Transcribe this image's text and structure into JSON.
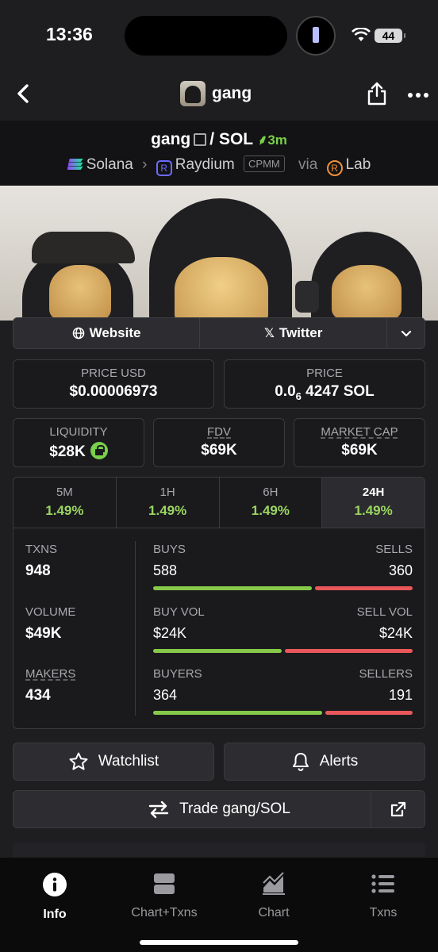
{
  "status_bar": {
    "time": "13:36",
    "battery": "44"
  },
  "header": {
    "title": "gang"
  },
  "pair": {
    "base": "gang",
    "quote": "SOL",
    "separator": "/",
    "age": "3m",
    "chain": "Solana",
    "dex": "Raydium",
    "pool_type": "CPMM",
    "via_label": "via",
    "launchpad": "Lab"
  },
  "links": {
    "website": "Website",
    "twitter": "Twitter"
  },
  "prices": {
    "price_usd_label": "PRICE USD",
    "price_usd": "$0.00006973",
    "price_label": "PRICE",
    "price_native_prefix": "0.0",
    "price_native_sub": "6",
    "price_native_rest": "4247 SOL"
  },
  "metrics": {
    "liquidity_label": "LIQUIDITY",
    "liquidity": "$28K",
    "fdv_label": "FDV",
    "fdv": "$69K",
    "mcap_label": "MARKET CAP",
    "mcap": "$69K"
  },
  "timeframes": [
    {
      "label": "5M",
      "change": "1.49%"
    },
    {
      "label": "1H",
      "change": "1.49%"
    },
    {
      "label": "6H",
      "change": "1.49%"
    },
    {
      "label": "24H",
      "change": "1.49%"
    }
  ],
  "active_timeframe": "24H",
  "stats": {
    "txns_label": "TXNS",
    "txns": "948",
    "volume_label": "VOLUME",
    "volume": "$49K",
    "makers_label": "MAKERS",
    "makers": "434",
    "buys_label": "BUYS",
    "buys": "588",
    "sells_label": "SELLS",
    "sells": "360",
    "buy_vol_label": "BUY VOL",
    "buy_vol": "$24K",
    "sell_vol_label": "SELL VOL",
    "sell_vol": "$24K",
    "buyers_label": "BUYERS",
    "buyers": "364",
    "sellers_label": "SELLERS",
    "sellers": "191",
    "buy_share": 0.62,
    "buy_vol_share": 0.5,
    "buyer_share": 0.66
  },
  "actions": {
    "watchlist": "Watchlist",
    "alerts": "Alerts",
    "trade": "Trade gang/SOL"
  },
  "tabbar": [
    {
      "label": "Info"
    },
    {
      "label": "Chart+Txns"
    },
    {
      "label": "Chart"
    },
    {
      "label": "Txns"
    }
  ],
  "colors": {
    "green": "#79d04a",
    "buy_bar": "#86c94a",
    "sell_bar": "#e9575a",
    "background": "#1e1e21"
  }
}
